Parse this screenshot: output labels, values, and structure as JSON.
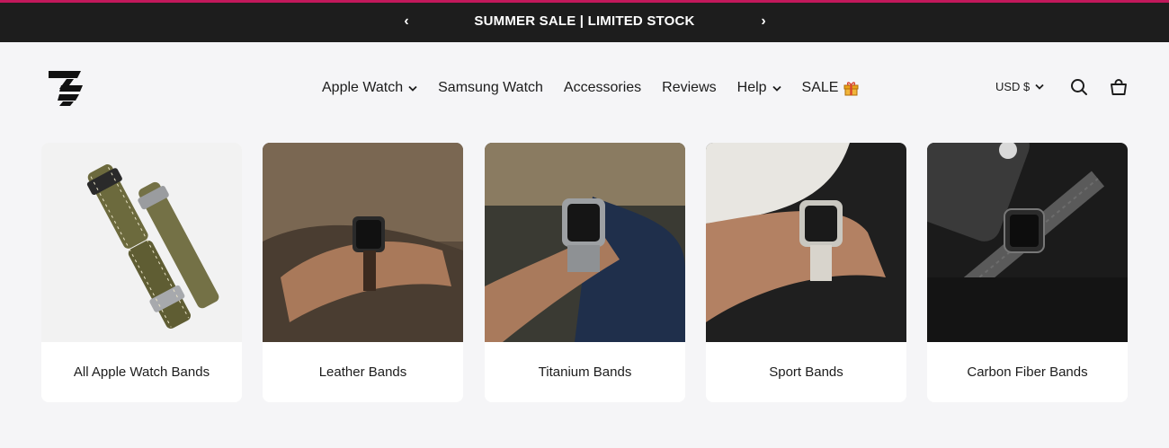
{
  "announcement": {
    "text": "SUMMER SALE | LIMITED STOCK",
    "prev_label": "‹",
    "next_label": "›"
  },
  "header": {
    "nav": [
      {
        "label": "Apple Watch",
        "has_dropdown": true
      },
      {
        "label": "Samsung Watch",
        "has_dropdown": false
      },
      {
        "label": "Accessories",
        "has_dropdown": false
      },
      {
        "label": "Reviews",
        "has_dropdown": false
      },
      {
        "label": "Help",
        "has_dropdown": true
      },
      {
        "label": "SALE",
        "has_dropdown": false,
        "icon": "gift-icon"
      }
    ],
    "currency": "USD $",
    "icons": [
      "search-icon",
      "cart-icon"
    ]
  },
  "collections": [
    {
      "label": "All Apple Watch Bands"
    },
    {
      "label": "Leather Bands"
    },
    {
      "label": "Titanium Bands"
    },
    {
      "label": "Sport Bands"
    },
    {
      "label": "Carbon Fiber Bands"
    }
  ],
  "colors": {
    "announcement_bg": "#1d1d1d",
    "announcement_accent": "#c2185b",
    "page_bg": "#f5f5f7",
    "gift": "#e8a21a"
  }
}
